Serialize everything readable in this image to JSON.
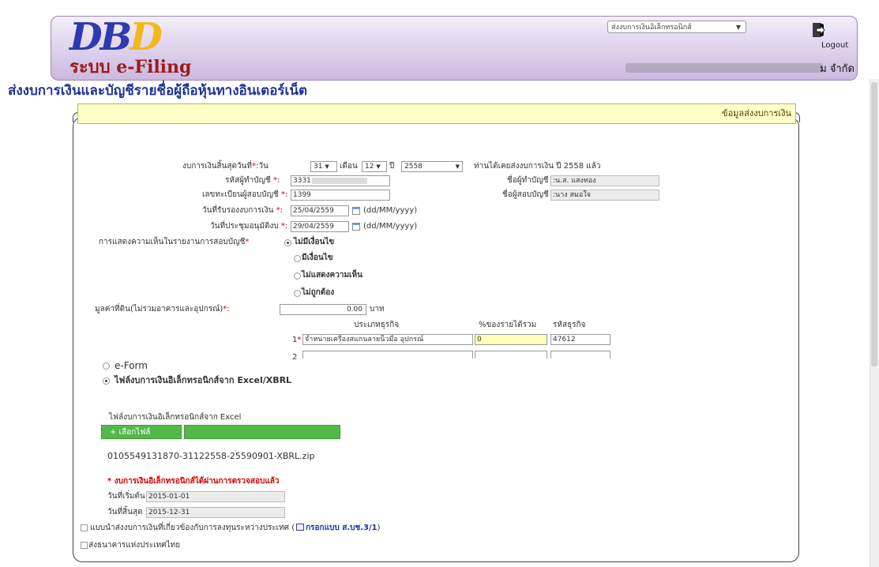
{
  "header": {
    "logo_text_main": "DB",
    "logo_text_accent": "D",
    "system_label": "ระบบ e-Filing",
    "menu_select_value": "ส่งงบการเงินอิเล็กทรอนิกส์",
    "logout_label": "Logout",
    "company_name": "ม จำกัด"
  },
  "page": {
    "title": "ส่งงบการเงินและบัญชีรายชื่อผู้ถือหุ้นทางอินเตอร์เน็ต"
  },
  "section": {
    "title": "ข้อมูลส่งงบการเงิน"
  },
  "form": {
    "fs_end_date_label": "งบการเงินสิ้นสุดวันที่",
    "day_label": "วัน",
    "day_value": "31",
    "month_label": "เดือน",
    "month_value": "12",
    "year_label": "ปี",
    "year_value": "2558",
    "already_submitted_note": "ท่านได้เคยส่งงบการเงิน ปี 2558 แล้ว",
    "accountant_id_label": "รหัสผู้ทำบัญชี",
    "accountant_id_value": "3331",
    "accountant_name_label": "ชื่อผู้ทำบัญชี",
    "accountant_name_value": ":น.ส. แสงทอง",
    "auditor_reg_label": "เลขทะเบียนผู้สอบบัญชี",
    "auditor_reg_value": "1399",
    "auditor_name_label": "ชื่อผู้สอบบัญชี",
    "auditor_name_value": ":นาง สมอใจ",
    "certify_date_label": "วันที่รับรองงบการเงิน",
    "certify_date_value": "25/04/2559",
    "certify_date_format": "(dd/MM/yyyy)",
    "meeting_date_label": "วันที่ประชุมอนุมัติงบ",
    "meeting_date_value": "29/04/2559",
    "meeting_date_format": "(dd/MM/yyyy)",
    "opinion_label": "การแสดงความเห็นในรายงานการสอบบัญชี",
    "opinion_options": [
      "ไม่มีเงื่อนไข",
      "มีเงื่อนไข",
      "ไม่แสดงความเห็น",
      "ไม่ถูกต้อง"
    ],
    "land_value_label": "มูลค่าที่ดิน(ไม่รวมอาคารและอุปกรณ์)",
    "land_value_value": "0.00",
    "land_value_unit": "บาท",
    "biz_type_header": "ประเภทธุรกิจ",
    "pct_income_header": "%ของรายได้รวม",
    "biz_code_header": "รหัสธุรกิจ",
    "row1_num": "1",
    "row1_type": "จำหน่ายเครื่องสแกนลายนิ้วมือ อุปกรณ์",
    "row1_pct": "0",
    "row1_code": "47612",
    "row2_num": "2"
  },
  "upload": {
    "eform_label": "e-Form",
    "excel_label": "ไฟล์งบการเงินอิเล็กทรอนิกส์จาก Excel/XBRL",
    "excel_file_label": "ไฟล์งบการเงินอิเล็กทรอนิกส์จาก Excel",
    "choose_file_label": "+ เลือกไฟล์",
    "file_name": "0105549131870-31122558-25590901-XBRL.zip",
    "verified_note": "* งบการเงินอิเล็กทรอนิกส์ได้ผ่านการตรวจสอบแล้ว",
    "start_date_label": "วันที่เริ่มต้น",
    "start_date_value": "2015-01-01",
    "end_date_label": "วันที่สิ้นสุด",
    "end_date_value": "2015-12-31",
    "intl_form_label": "แบบนำส่งงบการเงินที่เกี่ยวข้องกับการลงทุนระหว่างประเทศ (",
    "intl_form_link": "กรอกแบบ ส.บช.3/1",
    "intl_form_close": ")",
    "bot_label": "ส่งธนาคารแห่งประเทศไทย"
  },
  "colors": {
    "title_blue": "#1e3499",
    "section_yellow": "#ffffc8",
    "button_green": "#52b948",
    "required_red": "#d40000"
  }
}
